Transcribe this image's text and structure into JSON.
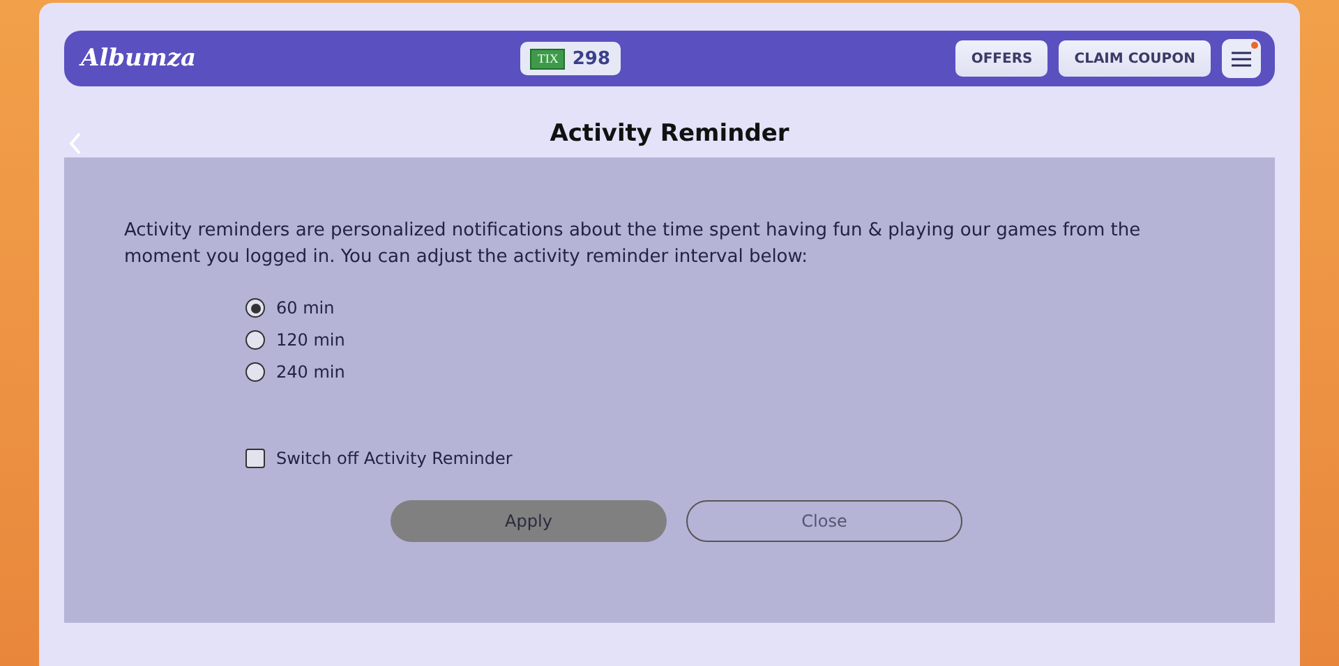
{
  "header": {
    "logo": "Albumza",
    "tickets": {
      "icon_label": "TIX",
      "count": "298"
    },
    "buttons": [
      "OFFERS",
      "CLAIM COUPON"
    ],
    "menu": {
      "notification": true
    }
  },
  "page": {
    "title": "Activity Reminder"
  },
  "description": "Activity reminders are personalized notifications about the time spent having fun & playing our games from the moment you logged in. You can adjust the activity reminder interval below:",
  "intervals": [
    {
      "label": "60 min",
      "selected": true
    },
    {
      "label": "120 min",
      "selected": false
    },
    {
      "label": "240 min",
      "selected": false
    }
  ],
  "switch_off": {
    "label": "Switch off Activity Reminder",
    "checked": false
  },
  "actions": [
    {
      "label": "Apply",
      "kind": "primary"
    },
    {
      "label": "Close",
      "kind": "outline"
    }
  ]
}
